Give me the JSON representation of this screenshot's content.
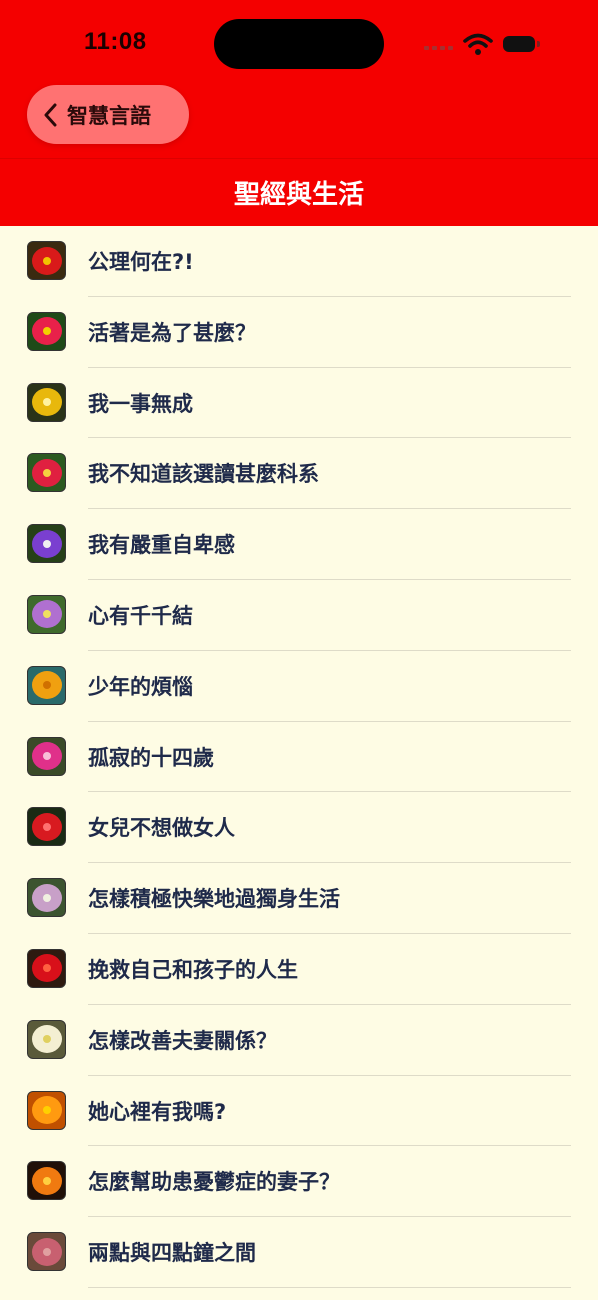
{
  "status_bar": {
    "time": "11:08"
  },
  "nav": {
    "back_label": "智慧言語",
    "title": "聖經與生活"
  },
  "colors": {
    "header": "#f40000",
    "back_button": "#ff7272",
    "background": "#fefce4",
    "text": "#1f2a4a"
  },
  "items": [
    {
      "label": "公理何在?!",
      "bg": "#3a2a10",
      "petal": "#d91a1a",
      "center": "#f2c200"
    },
    {
      "label": "活著是為了甚麼？",
      "bg": "#1f4a18",
      "petal": "#e8214a",
      "center": "#f2d000"
    },
    {
      "label": "我一事無成",
      "bg": "#2a3318",
      "petal": "#e8b80c",
      "center": "#fff2a0"
    },
    {
      "label": "我不知道該選讀甚麼科系",
      "bg": "#2c5a20",
      "petal": "#e02040",
      "center": "#f5d040"
    },
    {
      "label": "我有嚴重自卑感",
      "bg": "#264018",
      "petal": "#7a3fd0",
      "center": "#f0f0f0"
    },
    {
      "label": "心有千千結",
      "bg": "#3f6a2c",
      "petal": "#b070d0",
      "center": "#f0e060"
    },
    {
      "label": "少年的煩惱",
      "bg": "#2a6a6a",
      "petal": "#f0a010",
      "center": "#d07000"
    },
    {
      "label": "孤寂的十四歲",
      "bg": "#3a4a28",
      "petal": "#e0308a",
      "center": "#f8c0d8"
    },
    {
      "label": "女兒不想做女人",
      "bg": "#1a2a14",
      "petal": "#d81a20",
      "center": "#ff7070"
    },
    {
      "label": "怎樣積極快樂地過獨身生活",
      "bg": "#3c5430",
      "petal": "#c8a0c8",
      "center": "#f0f0e0"
    },
    {
      "label": "挽救自己和孩子的人生",
      "bg": "#2e1a10",
      "petal": "#d8101a",
      "center": "#ff6040"
    },
    {
      "label": "怎樣改善夫妻關係？",
      "bg": "#5a5a3a",
      "petal": "#f4efd2",
      "center": "#e0d060"
    },
    {
      "label": "她心裡有我嗎?",
      "bg": "#c05000",
      "petal": "#ff9a10",
      "center": "#ffd000"
    },
    {
      "label": "怎麼幫助患憂鬱症的妻子？",
      "bg": "#201008",
      "petal": "#f07a10",
      "center": "#ffd040"
    },
    {
      "label": "兩點與四點鐘之間",
      "bg": "#6a4a3a",
      "petal": "#c86070",
      "center": "#e0a0a0"
    }
  ]
}
